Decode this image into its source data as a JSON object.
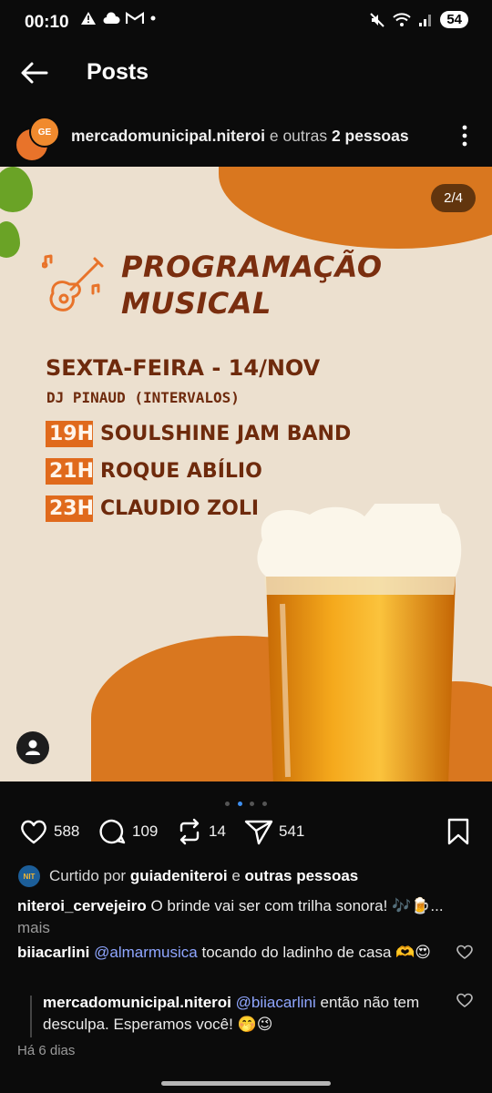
{
  "status_bar": {
    "time": "00:10",
    "battery": "54"
  },
  "header": {
    "title": "Posts"
  },
  "post": {
    "author": "mercadomunicipal.niteroi",
    "author_suffix": "e outras",
    "others_count": "2 pessoas",
    "avatar_badge_text": "GE",
    "image_counter": "2/4",
    "poster": {
      "title_line1": "PROGRAMAÇÃO",
      "title_line2": "MUSICAL",
      "date": "SEXTA-FEIRA - 14/NOV",
      "dj": "DJ PINAUD (INTERVALOS)",
      "lineup": [
        {
          "time": "19H",
          "artist": "SOULSHINE JAM BAND"
        },
        {
          "time": "21H",
          "artist": "ROQUE ABÍLIO"
        },
        {
          "time": "23H",
          "artist": "CLAUDIO ZOLI"
        }
      ]
    },
    "actions": {
      "likes": "588",
      "comments": "109",
      "reposts": "14",
      "shares": "541"
    },
    "liked_by": {
      "prefix": "Curtido por",
      "user": "guiadeniteroi",
      "joiner": "e",
      "suffix": "outras pessoas",
      "avatar_text": "NIT"
    },
    "caption": {
      "user": "niteroi_cervejeiro",
      "text": "O brinde vai ser com trilha sonora! 🎶🍺...",
      "more": "mais"
    },
    "comments": [
      {
        "user": "biiacarlini",
        "mention": "@almarmusica",
        "text": "tocando do ladinho de casa 🫶😍"
      },
      {
        "user": "mercadomunicipal.niteroi",
        "mention": "@biiacarlini",
        "text": "então não tem",
        "text2": "desculpa. Esperamos você! 🤭😉"
      }
    ],
    "timestamp": "Há 6 dias"
  },
  "colors": {
    "background": "#0b0b0b",
    "poster_orange": "#d9771f",
    "poster_brown": "#6e2a0c",
    "mention_blue": "#8fa6ff"
  }
}
